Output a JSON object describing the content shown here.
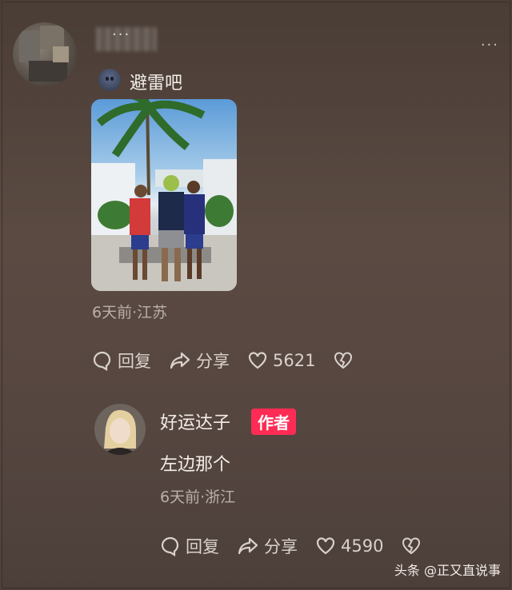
{
  "comment": {
    "author_dots": "...",
    "text": "避雷吧",
    "meta": "6天前·江苏",
    "reply_label": "回复",
    "share_label": "分享",
    "like_count": "5621"
  },
  "reply": {
    "author": "好运达子",
    "badge": "作者",
    "text": "左边那个",
    "meta": "6天前·浙江",
    "reply_label": "回复",
    "share_label": "分享",
    "like_count": "4590"
  },
  "watermark": "头条 @正又直说事",
  "colors": {
    "badge": "#fe2c55",
    "background": "#53443d"
  }
}
